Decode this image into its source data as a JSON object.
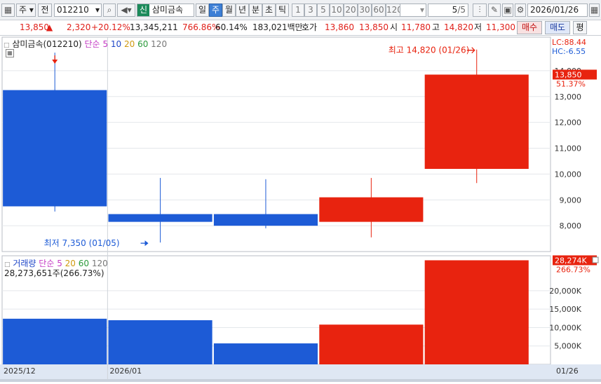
{
  "toolbar": {
    "market": "주",
    "prev_label": "전",
    "code": "012210",
    "badge": "신",
    "name": "삼미금속",
    "periods": [
      "일",
      "주",
      "월",
      "년",
      "분",
      "초",
      "틱"
    ],
    "active_period": "주",
    "intervals": [
      "1",
      "3",
      "5",
      "10",
      "20",
      "30",
      "60",
      "120"
    ],
    "page": "5",
    "page_total": "/5",
    "date": "2026/01/26"
  },
  "quote": {
    "price": "13,850",
    "arrow": "▲",
    "change": "2,320",
    "change_pct": "+20.12%",
    "volume": "13,345,211",
    "vol_ratio": "766.86%",
    "rate": "60.14%",
    "amount": "183,021백만",
    "bid_label": "호가",
    "ask": "13,860",
    "bid": "13,850",
    "open_label": "시",
    "open": "11,780",
    "high_label": "고",
    "high": "14,820",
    "low_label": "저",
    "low": "11,300",
    "buy": "매수",
    "sell": "매도",
    "eval": "평"
  },
  "price_panel": {
    "title": "삼미금속(012210)",
    "ma_label": "단순",
    "ma_periods": [
      "5",
      "10",
      "20",
      "60",
      "120"
    ],
    "ma_colors": [
      "#c43bc4",
      "#1f47c8",
      "#d09a10",
      "#2a9a3a",
      "#777777"
    ],
    "lc": "LC:88.44",
    "hc": "HC:-6.55",
    "current_price": "13,850",
    "current_pct": "51.37%",
    "high_note": "최고 14,820 (01/26)",
    "low_note": "최저 7,350 (01/05)"
  },
  "volume_panel": {
    "title": "거래량",
    "ma_label": "단순",
    "ma_periods": [
      "5",
      "20",
      "60",
      "120"
    ],
    "ma_colors": [
      "#c43bc4",
      "#d09a10",
      "#2a9a3a",
      "#777777"
    ],
    "summary": "28,273,651주(266.73%)",
    "current_vol": "28,274K",
    "current_pct": "266.73%"
  },
  "x_axis": {
    "labels": [
      "2025/12",
      "2026/01"
    ],
    "last": "01/26"
  },
  "colors": {
    "up": "#e8230f",
    "down": "#1d5bd6",
    "axis_text": "#333333"
  },
  "chart_data": [
    {
      "type": "candlestick",
      "title": "삼미금속(012210)",
      "candles": [
        {
          "open": 13250,
          "high": 14700,
          "low": 8550,
          "close": 8750,
          "direction": "down"
        },
        {
          "open": 8450,
          "high": 9850,
          "low": 7350,
          "close": 8150,
          "direction": "down"
        },
        {
          "open": 8450,
          "high": 9800,
          "low": 7900,
          "close": 8000,
          "direction": "down"
        },
        {
          "open": 8150,
          "high": 9850,
          "low": 7550,
          "close": 9100,
          "direction": "up"
        },
        {
          "open": 10200,
          "high": 14820,
          "low": 9650,
          "close": 13850,
          "direction": "up"
        }
      ],
      "y_ticks": [
        8000,
        9000,
        10000,
        11000,
        12000,
        13000,
        14000
      ],
      "y_tick_labels": [
        "8,000",
        "9,000",
        "10,000",
        "11,000",
        "12,000",
        "13,000",
        "14,000"
      ],
      "ylim": [
        7000,
        15300
      ]
    },
    {
      "type": "bar",
      "title": "거래량",
      "values": [
        12400000,
        12000000,
        5700000,
        10800000,
        28273651
      ],
      "directions": [
        "down",
        "down",
        "down",
        "up",
        "up"
      ],
      "y_ticks": [
        5000000,
        10000000,
        15000000,
        20000000
      ],
      "y_tick_labels": [
        "5,000K",
        "10,000K",
        "15,000K",
        "20,000K"
      ],
      "ylim": [
        0,
        29500000
      ]
    }
  ]
}
